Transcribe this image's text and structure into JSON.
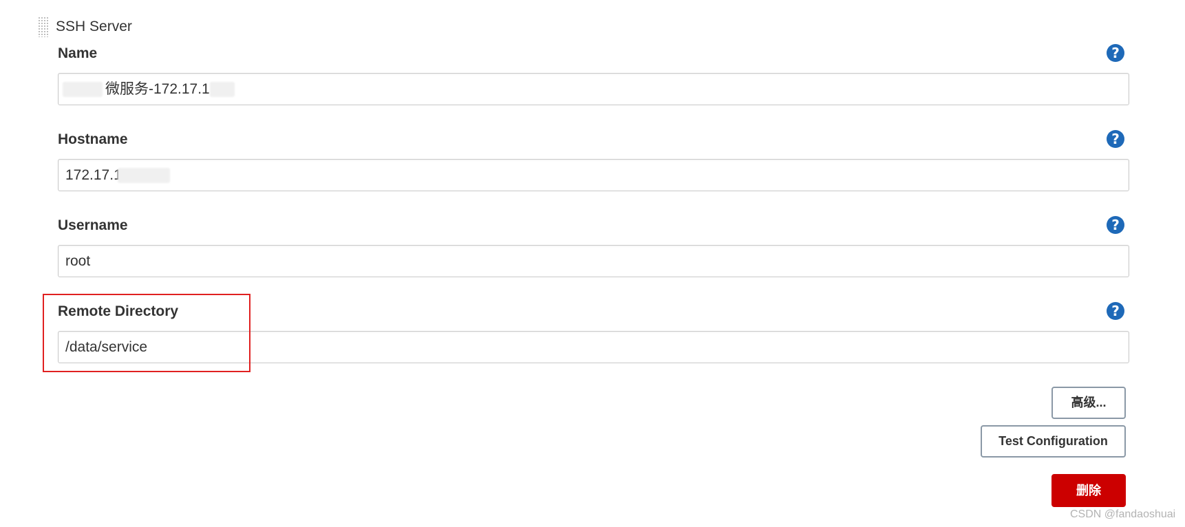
{
  "section": {
    "title": "SSH Server"
  },
  "fields": {
    "name": {
      "label": "Name",
      "value_prefix": "微服务-172.17.1"
    },
    "hostname": {
      "label": "Hostname",
      "value_prefix": "172.17.1"
    },
    "username": {
      "label": "Username",
      "value": "root"
    },
    "remote_directory": {
      "label": "Remote Directory",
      "value": "/data/service"
    }
  },
  "help": {
    "glyph": "?"
  },
  "buttons": {
    "advanced": "高级...",
    "test_configuration": "Test Configuration",
    "delete": "删除"
  },
  "watermark": "CSDN @fandaoshuai",
  "colors": {
    "help_icon": "#1e69b8",
    "delete_button": "#cc0000",
    "highlight_border": "#e02020"
  }
}
